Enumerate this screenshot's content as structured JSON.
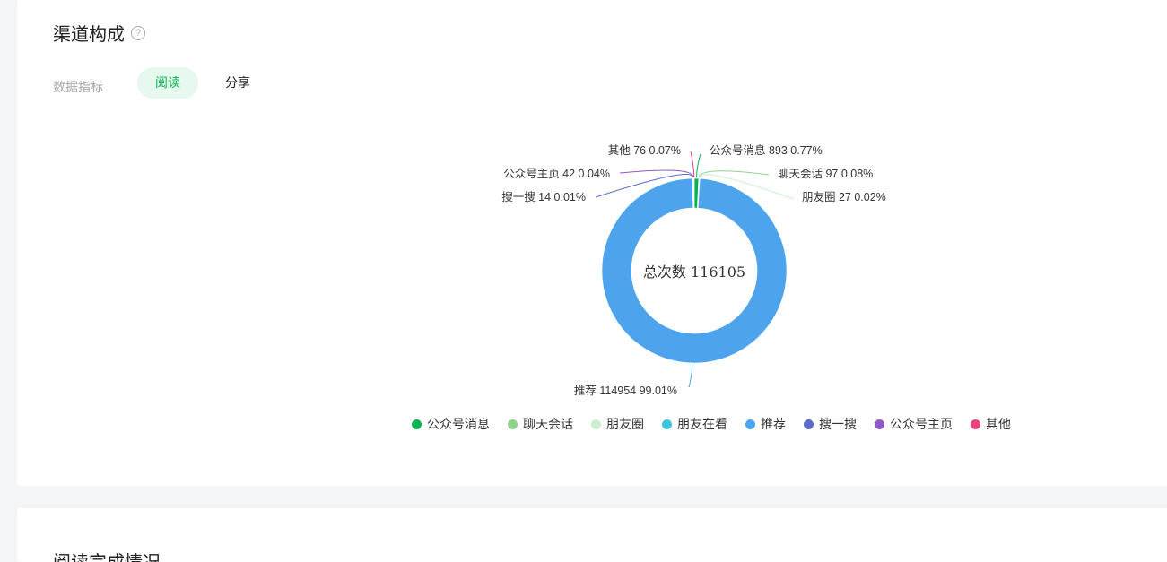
{
  "header": {
    "title": "渠道构成",
    "metric_label": "数据指标",
    "tabs": [
      {
        "label": "阅读",
        "active": true
      },
      {
        "label": "分享",
        "active": false
      }
    ]
  },
  "chart_data": {
    "type": "pie",
    "variant": "donut",
    "center_label": "总次数 116105",
    "total": 116105,
    "slices": [
      {
        "name": "公众号消息",
        "value": 893,
        "percent": "0.77%",
        "color": "#07b34f",
        "label": "公众号消息 893 0.77%"
      },
      {
        "name": "聊天会话",
        "value": 97,
        "percent": "0.08%",
        "color": "#8fd48b",
        "label": "聊天会话 97 0.08%"
      },
      {
        "name": "朋友圈",
        "value": 27,
        "percent": "0.02%",
        "color": "#cdeed0",
        "label": "朋友圈 27 0.02%"
      },
      {
        "name": "朋友在看",
        "value": 0,
        "percent": "",
        "color": "#3cc5db",
        "label": ""
      },
      {
        "name": "推荐",
        "value": 114954,
        "percent": "99.01%",
        "color": "#4ea4ec",
        "label": "推荐 114954 99.01%"
      },
      {
        "name": "搜一搜",
        "value": 14,
        "percent": "0.01%",
        "color": "#5d6bc9",
        "label": "搜一搜 14 0.01%"
      },
      {
        "name": "公众号主页",
        "value": 42,
        "percent": "0.04%",
        "color": "#8f59c9",
        "label": "公众号主页 42 0.04%"
      },
      {
        "name": "其他",
        "value": 76,
        "percent": "0.07%",
        "color": "#e8457f",
        "label": "其他 76 0.07%"
      }
    ],
    "legend": [
      "公众号消息",
      "聊天会话",
      "朋友圈",
      "朋友在看",
      "推荐",
      "搜一搜",
      "公众号主页",
      "其他"
    ],
    "legend_position": "bottom"
  },
  "next_section": {
    "partial_title": "阅读完成情况"
  }
}
